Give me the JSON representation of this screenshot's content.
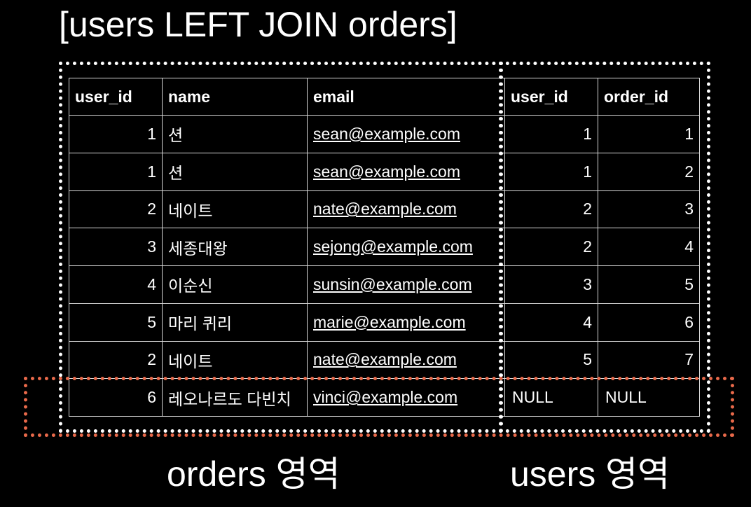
{
  "title": "[users LEFT JOIN orders]",
  "table": {
    "headers": [
      "user_id",
      "name",
      "email",
      "user_id",
      "order_id"
    ],
    "rows": [
      {
        "user_id": "1",
        "name": "션",
        "email": "sean@example.com",
        "order_user_id": "1",
        "order_id": "1"
      },
      {
        "user_id": "1",
        "name": "션",
        "email": "sean@example.com",
        "order_user_id": "1",
        "order_id": "2"
      },
      {
        "user_id": "2",
        "name": "네이트",
        "email": "nate@example.com",
        "order_user_id": "2",
        "order_id": "3"
      },
      {
        "user_id": "3",
        "name": "세종대왕",
        "email": "sejong@example.com",
        "order_user_id": "2",
        "order_id": "4"
      },
      {
        "user_id": "4",
        "name": "이순신",
        "email": "sunsin@example.com",
        "order_user_id": "3",
        "order_id": "5"
      },
      {
        "user_id": "5",
        "name": "마리 퀴리",
        "email": "marie@example.com",
        "order_user_id": "4",
        "order_id": "6"
      },
      {
        "user_id": "2",
        "name": "네이트",
        "email": "nate@example.com",
        "order_user_id": "5",
        "order_id": "7"
      },
      {
        "user_id": "6",
        "name": "레오나르도 다빈치",
        "email": "vinci@example.com",
        "order_user_id": "NULL",
        "order_id": "NULL"
      }
    ]
  },
  "captions": {
    "left": "orders 영역",
    "right": "users 영역"
  },
  "colors": {
    "background": "#000000",
    "text": "#ffffff",
    "region_outline": "#ffffff",
    "null_row_highlight": "#e8694a"
  }
}
